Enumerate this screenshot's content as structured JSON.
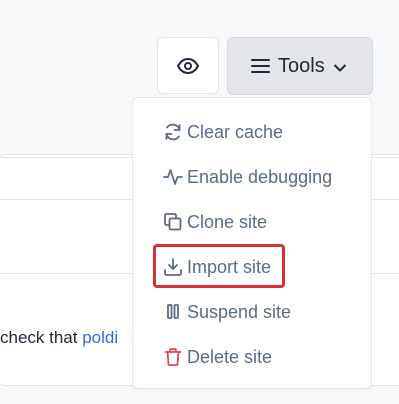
{
  "header": {
    "eye_icon": "eye-icon",
    "tools_label": "Tools"
  },
  "background": {
    "text_before_link": "check that ",
    "link_text": "poldi"
  },
  "dropdown": {
    "items": [
      {
        "label": "Clear cache",
        "icon": "refresh-icon"
      },
      {
        "label": "Enable debugging",
        "icon": "activity-icon"
      },
      {
        "label": "Clone site",
        "icon": "copy-icon"
      },
      {
        "label": "Import site",
        "icon": "download-icon",
        "highlighted": true
      },
      {
        "label": "Suspend site",
        "icon": "pause-icon"
      },
      {
        "label": "Delete site",
        "icon": "trash-icon",
        "icon_color": "#e0455a"
      }
    ]
  },
  "colors": {
    "menu_text": "#5b6b86",
    "highlight": "#d92f3a",
    "link": "#2f6fd6"
  }
}
